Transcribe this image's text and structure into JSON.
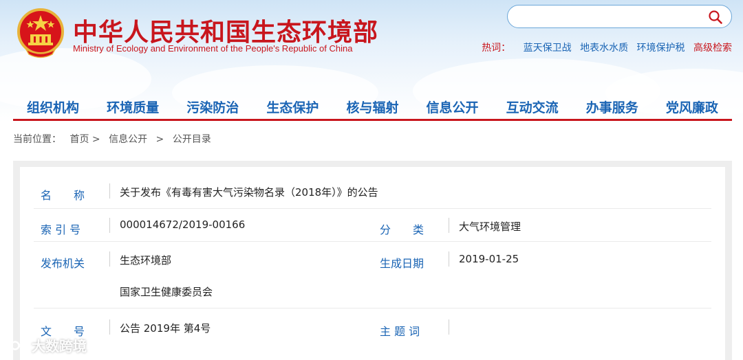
{
  "site": {
    "title_cn": "中华人民共和国生态环境部",
    "title_en": "Ministry of Ecology and Environment of the People's Republic of China"
  },
  "search": {
    "placeholder": ""
  },
  "hotwords": {
    "label": "热词：",
    "items": [
      "蓝天保卫战",
      "地表水水质",
      "环境保护税"
    ],
    "advanced": "高级检索"
  },
  "nav": {
    "items": [
      "组织机构",
      "环境质量",
      "污染防治",
      "生态保护",
      "核与辐射",
      "信息公开",
      "互动交流",
      "办事服务",
      "党风廉政"
    ]
  },
  "breadcrumb": {
    "prefix": "当前位置：",
    "items": [
      "首页 >",
      "信息公开",
      ">",
      "公开目录"
    ]
  },
  "doc": {
    "name_label": "名　　称",
    "name_value": "关于发布《有毒有害大气污染物名录（2018年）》的公告",
    "index_label": "索 引 号",
    "index_value": "000014672/2019-00166",
    "category_label": "分　　类",
    "category_value": "大气环境管理",
    "issuer_label": "发布机关",
    "issuer_values": [
      "生态环境部",
      "国家卫生健康委员会"
    ],
    "date_label": "生成日期",
    "date_value": "2019-01-25",
    "docno_label": "文　　号",
    "docno_value": "公告 2019年 第4号",
    "subject_label": "主 题 词",
    "subject_value": ""
  },
  "watermark": {
    "text": "大数跨境"
  },
  "colors": {
    "brand_red": "#c8161d",
    "link_blue": "#1a64b4"
  }
}
